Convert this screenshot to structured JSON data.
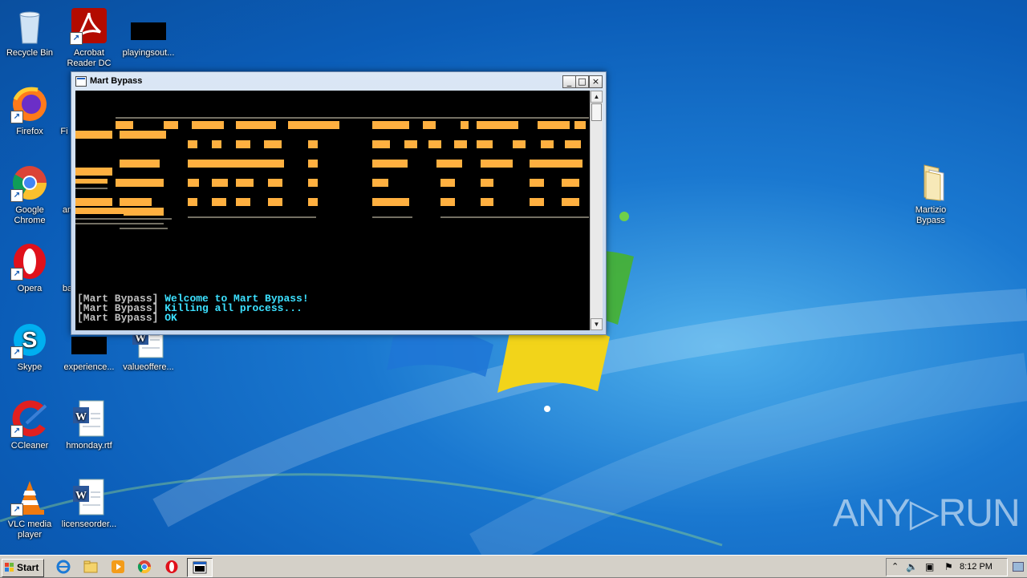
{
  "desktop": {
    "icons": [
      {
        "label": "Recycle Bin",
        "icon": "recycle-bin-icon"
      },
      {
        "label": "Acrobat Reader DC",
        "icon": "acrobat-icon"
      },
      {
        "label": "playingsout...",
        "icon": "black-file-icon"
      },
      {
        "label": "Firefox",
        "icon": "firefox-icon"
      },
      {
        "label": "Fi",
        "icon": "file-icon"
      },
      {
        "label": "Google Chrome",
        "icon": "chrome-icon"
      },
      {
        "label": "an",
        "icon": "file-icon"
      },
      {
        "label": "Opera",
        "icon": "opera-icon"
      },
      {
        "label": "ba",
        "icon": "file-icon"
      },
      {
        "label": "Skype",
        "icon": "skype-icon"
      },
      {
        "label": "experience...",
        "icon": "black-file-icon"
      },
      {
        "label": "valueoffere...",
        "icon": "word-doc-icon"
      },
      {
        "label": "CCleaner",
        "icon": "ccleaner-icon"
      },
      {
        "label": "hmonday.rtf",
        "icon": "word-doc-icon"
      },
      {
        "label": "VLC media player",
        "icon": "vlc-icon"
      },
      {
        "label": "licenseorder...",
        "icon": "word-doc-icon"
      },
      {
        "label": "Martizio Bypass",
        "icon": "folder-icon"
      }
    ]
  },
  "console": {
    "title": "Mart Bypass",
    "minimize": "_",
    "maximize": "□",
    "close": "×",
    "banner_color": "#ffb040",
    "lines": [
      {
        "tag": "[Mart Bypass]",
        "msg": "Welcome to Mart Bypass!"
      },
      {
        "tag": "[Mart Bypass]",
        "msg": "Killing all process..."
      },
      {
        "tag": "[Mart Bypass]",
        "msg": "OK"
      }
    ]
  },
  "taskbar": {
    "start_label": "Start",
    "pinned": [
      "ie-icon",
      "explorer-icon",
      "media-player-icon",
      "chrome-icon",
      "opera-icon",
      "console-icon"
    ],
    "clock": "8:12 PM"
  },
  "watermark": "ANY▷RUN"
}
